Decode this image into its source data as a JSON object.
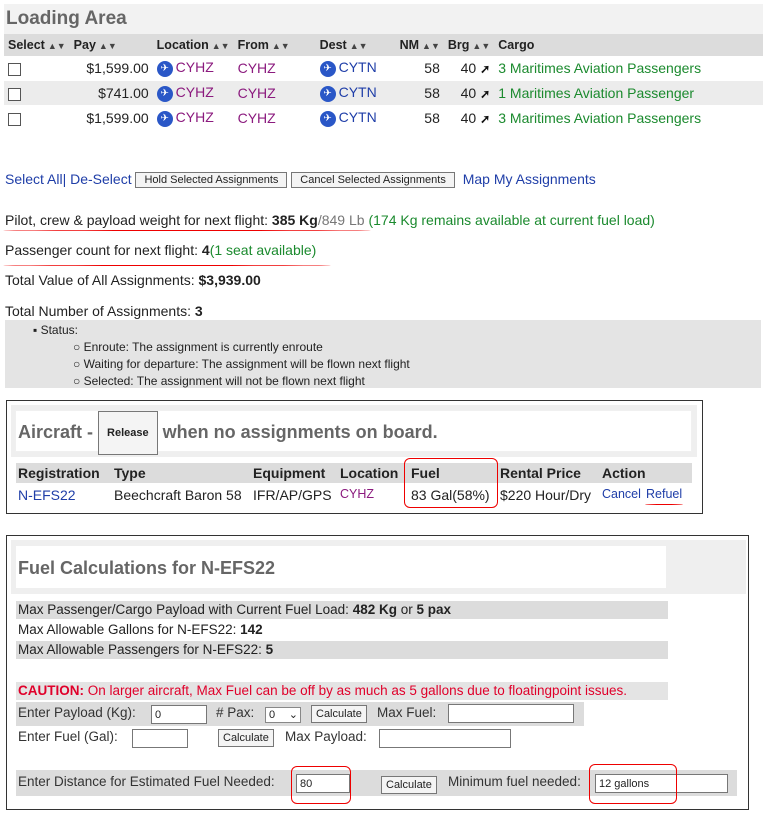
{
  "loading_area": {
    "title": "Loading Area",
    "columns": [
      "Select",
      "Pay",
      "Location",
      "From",
      "Dest",
      "NM",
      "Brg",
      "Cargo"
    ],
    "rows": [
      {
        "pay": "$1,599.00",
        "location": "CYHZ",
        "from": "CYHZ",
        "dest": "CYTN",
        "nm": "58",
        "brg": "40",
        "cargo": "3 Maritimes Aviation Passengers"
      },
      {
        "pay": "$741.00",
        "location": "CYHZ",
        "from": "CYHZ",
        "dest": "CYTN",
        "nm": "58",
        "brg": "40",
        "cargo": "1 Maritimes Aviation Passenger"
      },
      {
        "pay": "$1,599.00",
        "location": "CYHZ",
        "from": "CYHZ",
        "dest": "CYTN",
        "nm": "58",
        "brg": "40",
        "cargo": "3 Maritimes Aviation Passengers"
      }
    ]
  },
  "actions": {
    "select_all": "Select All",
    "separator": "|",
    "deselect": "De-Select",
    "hold_button": "Hold Selected Assignments",
    "cancel_button": "Cancel Selected Assignments",
    "map_link": "Map My Assignments"
  },
  "summary": {
    "weight_label": "Pilot, crew & payload weight for next flight:",
    "weight_kg": "385 Kg",
    "weight_lb": "/849 Lb",
    "weight_remaining": "(174 Kg remains available at current fuel load)",
    "pax_label": "Passenger count for next flight:",
    "pax_count": "4",
    "pax_available": "(1 seat available)",
    "total_value_label": "Total Value of All Assignments:",
    "total_value": "$3,939.00",
    "total_count_label": "Total Number of Assignments:",
    "total_count": "3"
  },
  "status": {
    "heading": "Status:",
    "items": [
      "Enroute: The assignment is currently enroute",
      "Waiting for departure: The assignment will be flown next flight",
      "Selected: The assignment will not be flown next flight"
    ]
  },
  "aircraft": {
    "title_prefix": "Aircraft -",
    "release_button": "Release",
    "title_suffix": "when no assignments on board.",
    "columns": [
      "Registration",
      "Type",
      "Equipment",
      "Location",
      "Fuel",
      "Rental Price",
      "Action"
    ],
    "row": {
      "registration": "N-EFS22",
      "type": "Beechcraft Baron 58",
      "equipment": "IFR/AP/GPS",
      "location": "CYHZ",
      "fuel": "83 Gal(58%)",
      "rental": "$220 Hour/Dry",
      "cancel": "Cancel",
      "refuel": "Refuel"
    }
  },
  "fuel": {
    "title": "Fuel Calculations for N-EFS22",
    "max_payload_label": "Max Passenger/Cargo Payload with Current Fuel Load:",
    "max_payload_kg": "482 Kg",
    "or": "or",
    "max_payload_pax": "5 pax",
    "max_gallons_label": "Max Allowable Gallons for N-EFS22:",
    "max_gallons": "142",
    "max_pax_label": "Max Allowable Passengers for N-EFS22:",
    "max_pax": "5",
    "caution_label": "CAUTION:",
    "caution_text": "On larger aircraft, Max Fuel can be off by as much as 5 gallons due to floatingpoint issues.",
    "payload_label": "Enter Payload (Kg):",
    "payload_value": "0",
    "pax_label": "# Pax:",
    "pax_value": "0",
    "calculate": "Calculate",
    "max_fuel_label": "Max Fuel:",
    "fuel_label": "Enter Fuel (Gal):",
    "max_payload_out_label": "Max Payload:",
    "distance_label": "Enter Distance for Estimated Fuel Needed:",
    "distance_value": "80",
    "min_fuel_label": "Minimum fuel needed:",
    "min_fuel_value": "12 gallons"
  }
}
